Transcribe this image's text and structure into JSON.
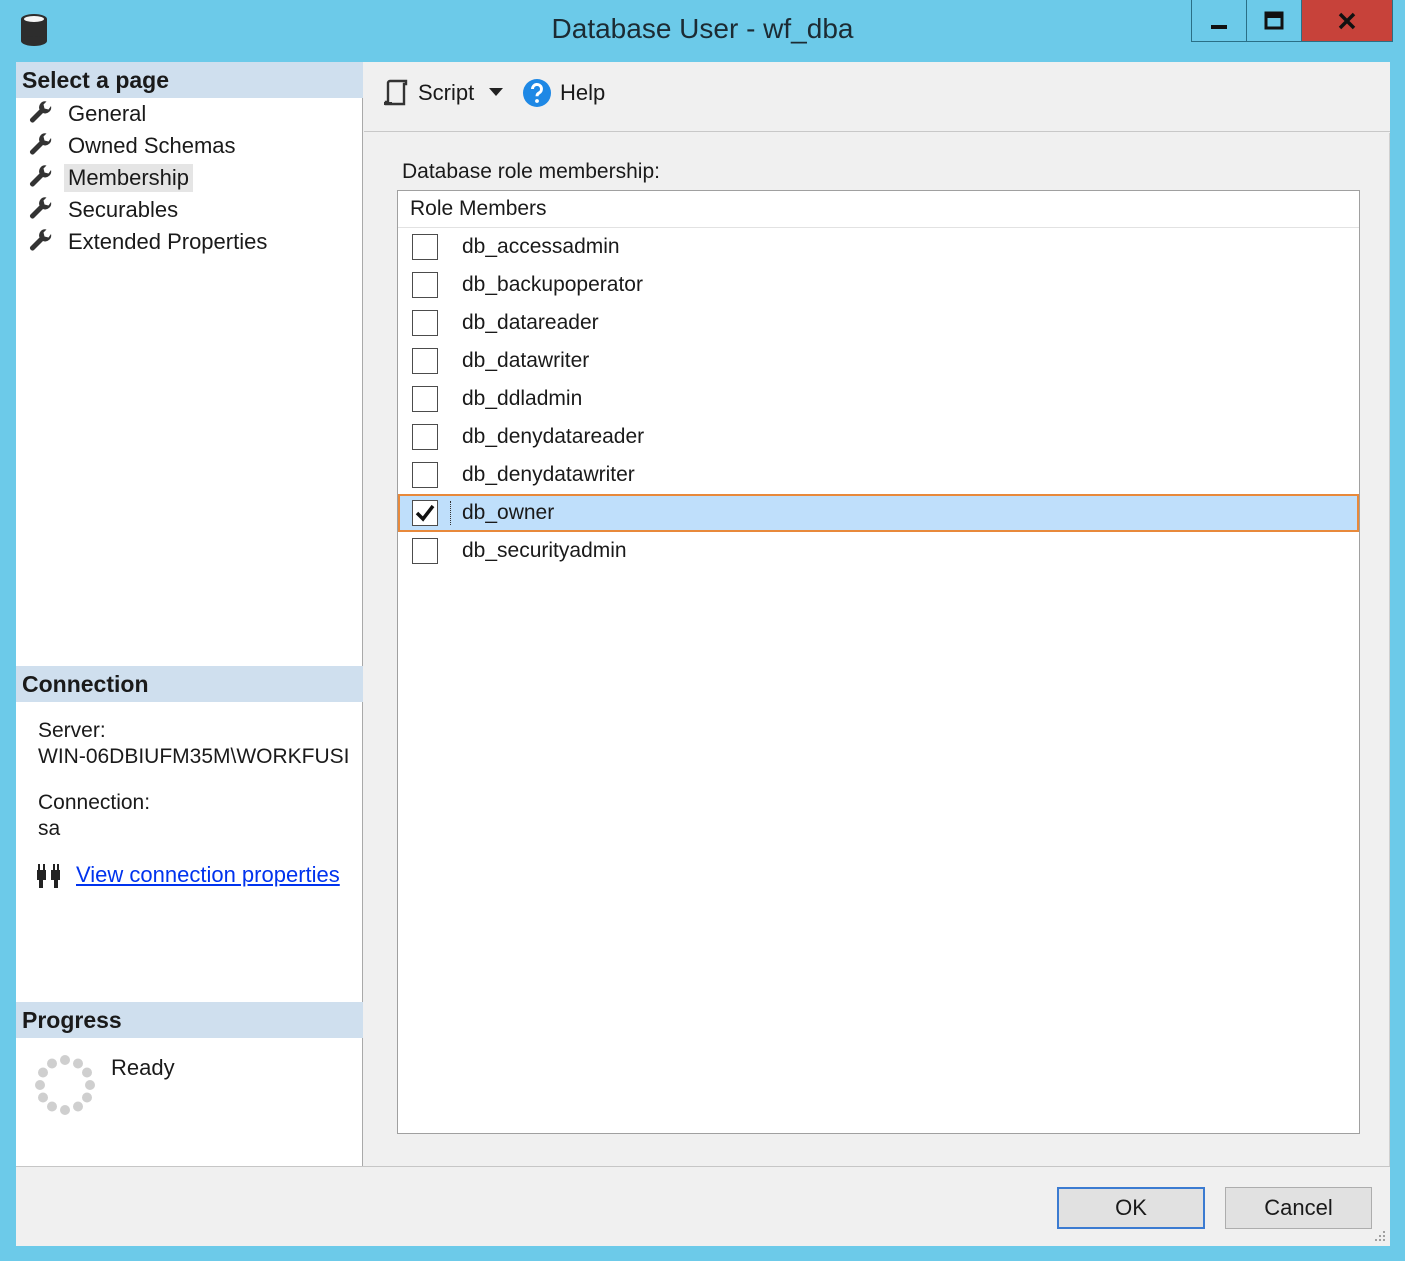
{
  "window": {
    "title": "Database User - wf_dba",
    "minimize_icon": "minimize-icon",
    "maximize_icon": "maximize-icon",
    "close_icon": "close-icon",
    "app_icon": "database-icon"
  },
  "select_page": {
    "header": "Select a page",
    "items": [
      {
        "label": "General",
        "icon": "wrench-icon",
        "active": false
      },
      {
        "label": "Owned Schemas",
        "icon": "wrench-icon",
        "active": false
      },
      {
        "label": "Membership",
        "icon": "wrench-icon",
        "active": true
      },
      {
        "label": "Securables",
        "icon": "wrench-icon",
        "active": false
      },
      {
        "label": "Extended Properties",
        "icon": "wrench-icon",
        "active": false
      }
    ]
  },
  "connection": {
    "header": "Connection",
    "server_label": "Server:",
    "server_value": "WIN-06DBIUFM35M\\WORKFUSI",
    "connection_label": "Connection:",
    "connection_value": "sa",
    "link_text": "View connection properties",
    "link_icon": "connection-plug-icon"
  },
  "progress": {
    "header": "Progress",
    "status": "Ready",
    "icon": "spinner-icon"
  },
  "toolbar": {
    "script_label": "Script",
    "script_icon": "script-icon",
    "dropdown_icon": "dropdown-arrow-icon",
    "help_label": "Help",
    "help_icon": "help-icon"
  },
  "membership": {
    "list_label": "Database role membership:",
    "column_header": "Role Members",
    "roles": [
      {
        "name": "db_accessadmin",
        "checked": false,
        "selected": false
      },
      {
        "name": "db_backupoperator",
        "checked": false,
        "selected": false
      },
      {
        "name": "db_datareader",
        "checked": false,
        "selected": false
      },
      {
        "name": "db_datawriter",
        "checked": false,
        "selected": false
      },
      {
        "name": "db_ddladmin",
        "checked": false,
        "selected": false
      },
      {
        "name": "db_denydatareader",
        "checked": false,
        "selected": false
      },
      {
        "name": "db_denydatawriter",
        "checked": false,
        "selected": false
      },
      {
        "name": "db_owner",
        "checked": true,
        "selected": true
      },
      {
        "name": "db_securityadmin",
        "checked": false,
        "selected": false
      }
    ]
  },
  "buttons": {
    "ok_label": "OK",
    "cancel_label": "Cancel"
  },
  "colors": {
    "title_bar": "#6ccae9",
    "close_button": "#c7423a",
    "section_header": "#cfdfee",
    "selected_row": "#bfdffb",
    "focus_outline": "#e8893b",
    "link": "#0033ee"
  }
}
